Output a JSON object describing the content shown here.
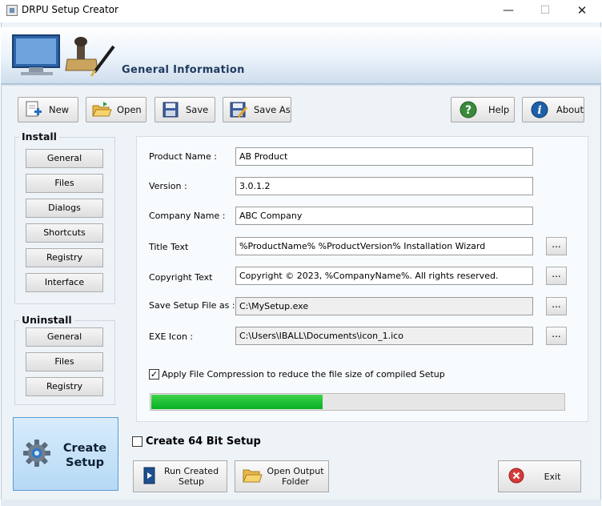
{
  "window": {
    "title": "DRPU Setup Creator",
    "min_glyph": "—",
    "max_glyph": "☐",
    "close_glyph": "✕"
  },
  "header": {
    "title": "General Information"
  },
  "toolbar": {
    "new_label": "New",
    "open_label": "Open",
    "save_label": "Save",
    "saveas_label": "Save As",
    "help_label": "Help",
    "about_label": "About"
  },
  "install": {
    "title": "Install",
    "items": [
      {
        "label": "General"
      },
      {
        "label": "Files"
      },
      {
        "label": "Dialogs"
      },
      {
        "label": "Shortcuts"
      },
      {
        "label": "Registry"
      },
      {
        "label": "Interface"
      }
    ]
  },
  "uninstall": {
    "title": "Uninstall",
    "items": [
      {
        "label": "General"
      },
      {
        "label": "Files"
      },
      {
        "label": "Registry"
      }
    ]
  },
  "form": {
    "product_name": {
      "label": "Product Name :",
      "value": "AB Product"
    },
    "version": {
      "label": "Version :",
      "value": "3.0.1.2"
    },
    "company_name": {
      "label": "Company Name :",
      "value": "ABC Company"
    },
    "title_text": {
      "label": "Title Text",
      "value": "%ProductName% %ProductVersion% Installation Wizard"
    },
    "copyright_text": {
      "label": "Copyright Text",
      "value": "Copyright © 2023, %CompanyName%. All rights reserved."
    },
    "save_setup": {
      "label": "Save Setup File as :",
      "value": "C:\\MySetup.exe"
    },
    "exe_icon": {
      "label": "EXE Icon :",
      "value": "C:\\Users\\IBALL\\Documents\\icon_1.ico"
    },
    "browse_label": "...",
    "compression": {
      "label": "Apply File Compression to reduce the file size of compiled Setup",
      "checked": true,
      "check_glyph": "✓"
    },
    "progress": 0.415
  },
  "create_setup": {
    "label_line1": "Create",
    "label_line2": "Setup"
  },
  "create64": {
    "label": "Create 64 Bit Setup",
    "checked": false
  },
  "actions": {
    "run_line1": "Run Created",
    "run_line2": "Setup",
    "open_line1": "Open Output",
    "open_line2": "Folder",
    "exit_label": "Exit"
  },
  "colors": {
    "accent": "#1f3a5f",
    "progress": "#06b025",
    "help": "#3a8a3a",
    "about": "#1e5fa8",
    "exit": "#d63a3a"
  }
}
